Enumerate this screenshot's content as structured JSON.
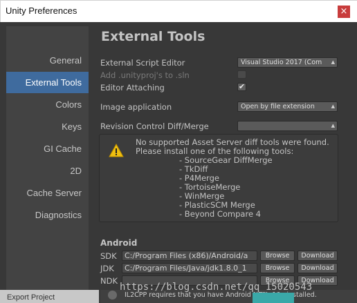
{
  "window": {
    "title": "Unity Preferences",
    "close_glyph": "×"
  },
  "sidebar": {
    "items": [
      {
        "label": "General",
        "active": false
      },
      {
        "label": "External Tools",
        "active": true
      },
      {
        "label": "Colors",
        "active": false
      },
      {
        "label": "Keys",
        "active": false
      },
      {
        "label": "GI Cache",
        "active": false
      },
      {
        "label": "2D",
        "active": false
      },
      {
        "label": "Cache Server",
        "active": false
      },
      {
        "label": "Diagnostics",
        "active": false
      }
    ],
    "bottom_item": "Export Project"
  },
  "main": {
    "heading": "External Tools",
    "external_script_editor": {
      "label": "External Script Editor",
      "value": "Visual Studio 2017 (Com"
    },
    "add_unityproj": {
      "label": "Add .unityproj's to .sln",
      "checked": false
    },
    "editor_attaching": {
      "label": "Editor Attaching",
      "checked": true,
      "check_glyph": "✔"
    },
    "image_application": {
      "label": "Image application",
      "value": "Open by file extension"
    },
    "revision_control": {
      "label": "Revision Control Diff/Merge",
      "value": ""
    },
    "help": {
      "line1": "No supported Asset Server diff tools were found.",
      "line2": "Please install one of the following tools:",
      "tools": [
        "- SourceGear DiffMerge",
        "- TkDiff",
        "- P4Merge",
        "- TortoiseMerge",
        "- WinMerge",
        "- PlasticSCM Merge",
        "- Beyond Compare 4"
      ]
    },
    "android": {
      "section": "Android",
      "sdk": {
        "label": "SDK",
        "value": "C:/Program Files (x86)/Android/a"
      },
      "jdk": {
        "label": "JDK",
        "value": "C:/Program Files/Java/jdk1.8.0_1"
      },
      "ndk": {
        "label": "NDK",
        "value": ""
      },
      "browse_label": "Browse",
      "download_label": "Download",
      "il2cpp_note": "IL2CPP requires that you have Android NDK r10e installed."
    }
  },
  "watermark": "https://blog.csdn.net/qq_15020543",
  "colors": {
    "accent": "#3f6b9e",
    "panel": "#383838",
    "warning": "#f0c010"
  }
}
